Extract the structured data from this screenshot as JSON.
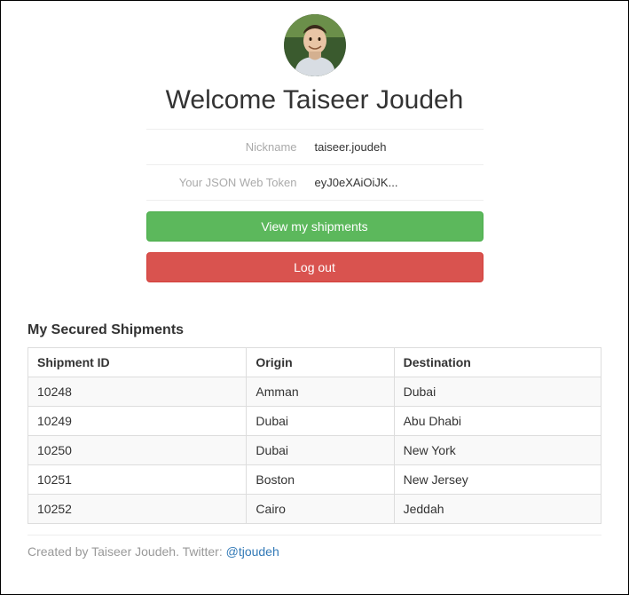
{
  "profile": {
    "welcome_text": "Welcome Taiseer Joudeh",
    "nickname_label": "Nickname",
    "nickname_value": "taiseer.joudeh",
    "token_label": "Your JSON Web Token",
    "token_value": "eyJ0eXAiOiJK..."
  },
  "buttons": {
    "view_shipments": "View my shipments",
    "logout": "Log out"
  },
  "shipments": {
    "section_title": "My Secured Shipments",
    "columns": {
      "id": "Shipment ID",
      "origin": "Origin",
      "destination": "Destination"
    },
    "rows": [
      {
        "id": "10248",
        "origin": "Amman",
        "destination": "Dubai"
      },
      {
        "id": "10249",
        "origin": "Dubai",
        "destination": "Abu Dhabi"
      },
      {
        "id": "10250",
        "origin": "Dubai",
        "destination": "New York"
      },
      {
        "id": "10251",
        "origin": "Boston",
        "destination": "New Jersey"
      },
      {
        "id": "10252",
        "origin": "Cairo",
        "destination": "Jeddah"
      }
    ]
  },
  "footer": {
    "text_before": "Created by Taiseer Joudeh. Twitter: ",
    "link_text": "@tjoudeh"
  }
}
